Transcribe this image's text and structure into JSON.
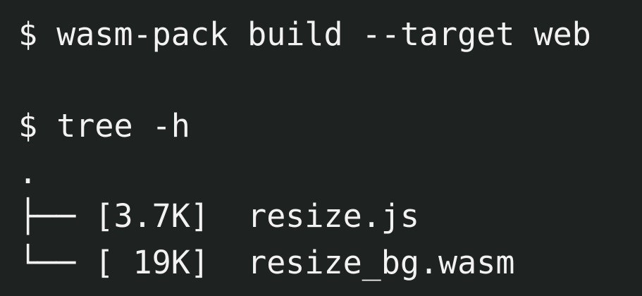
{
  "terminal": {
    "lines": [
      {
        "prompt": "$",
        "command": "wasm-pack build --target web"
      },
      {
        "prompt": "$",
        "command": "tree -h"
      }
    ],
    "tree": {
      "root": ".",
      "entries": [
        {
          "branch": "├──",
          "size": "[3.7K]",
          "name": "resize.js"
        },
        {
          "branch": "└──",
          "size": "[ 19K]",
          "name": "resize_bg.wasm"
        }
      ]
    }
  }
}
